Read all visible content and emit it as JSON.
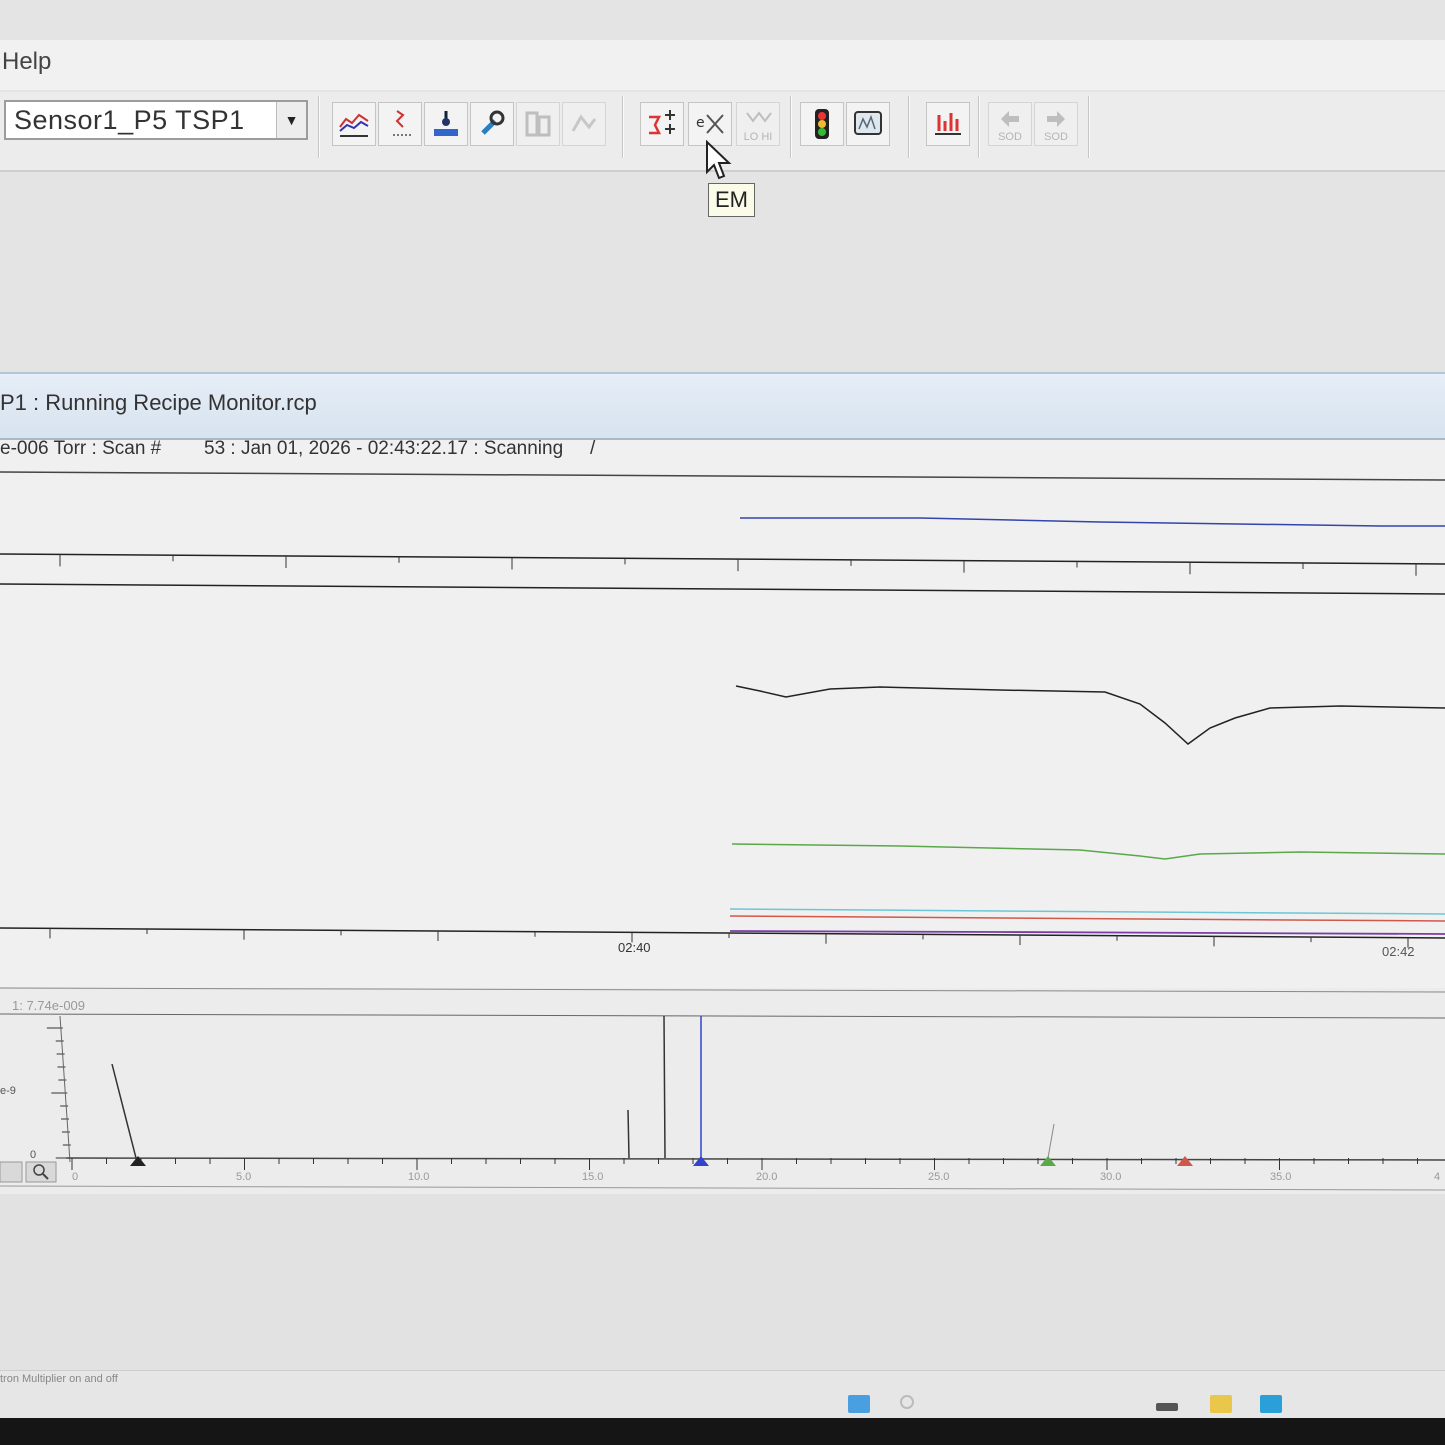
{
  "menu": {
    "help_label": "Help"
  },
  "toolbar": {
    "sensor_value": "Sensor1_P5 TSP1",
    "sod_back_label": "SOD",
    "sod_forward_label": "SOD",
    "lohi_label": "LO HI",
    "tooltip": "EM"
  },
  "monitor": {
    "title": "P1 : Running Recipe Monitor.rcp",
    "status_pressure": "e-006 Torr : Scan #",
    "status_scan": "53 : Jan 01, 2026 - 02:43:22.17 : Scanning",
    "status_spinner": "/"
  },
  "trend": {
    "tick_labels": [
      "02:40",
      "02:42"
    ],
    "colors": {
      "blue": "#3344aa",
      "black": "#222222",
      "green": "#5aa84a",
      "cyan": "#6cc6d6",
      "red": "#d0584a",
      "purple": "#7a3ca8"
    }
  },
  "spectrum": {
    "header_label": "1: 7.74e-009",
    "y_label_mid": "e-9",
    "y_label_zero": "0",
    "x_tick_labels": [
      "0",
      "5.0",
      "10.0",
      "15.0",
      "20.0",
      "25.0",
      "30.0",
      "35.0",
      "4"
    ]
  },
  "statusbar": {
    "hint": "tron Multiplier on and off"
  }
}
